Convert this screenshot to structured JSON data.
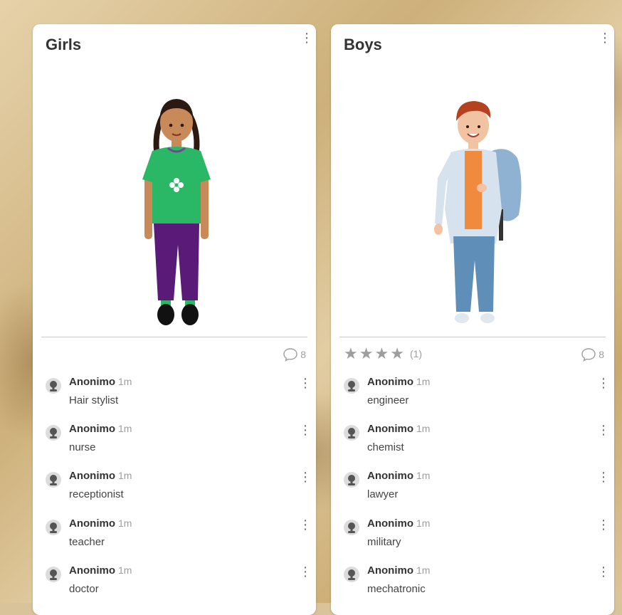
{
  "cards": [
    {
      "title": "Girls",
      "rating": null,
      "comment_count": "8",
      "comments": [
        {
          "author": "Anonimo",
          "time": "1m",
          "text": "Hair stylist"
        },
        {
          "author": "Anonimo",
          "time": "1m",
          "text": "nurse"
        },
        {
          "author": "Anonimo",
          "time": "1m",
          "text": "receptionist"
        },
        {
          "author": "Anonimo",
          "time": "1m",
          "text": "teacher"
        },
        {
          "author": "Anonimo",
          "time": "1m",
          "text": "doctor"
        }
      ]
    },
    {
      "title": "Boys",
      "rating": {
        "stars": 4,
        "count_label": "(1)"
      },
      "comment_count": "8",
      "comments": [
        {
          "author": "Anonimo",
          "time": "1m",
          "text": "engineer"
        },
        {
          "author": "Anonimo",
          "time": "1m",
          "text": "chemist"
        },
        {
          "author": "Anonimo",
          "time": "1m",
          "text": "lawyer"
        },
        {
          "author": "Anonimo",
          "time": "1m",
          "text": "military"
        },
        {
          "author": "Anonimo",
          "time": "1m",
          "text": "mechatronic"
        }
      ]
    }
  ],
  "icons": {
    "menu": "kebab-menu-icon",
    "comments": "speech-bubble-icon",
    "star": "star-icon",
    "avatar": "anonymous-avatar-icon"
  },
  "colors": {
    "card_bg": "#ffffff",
    "muted_gray": "#9e9e9e",
    "text_dark": "#333333"
  }
}
